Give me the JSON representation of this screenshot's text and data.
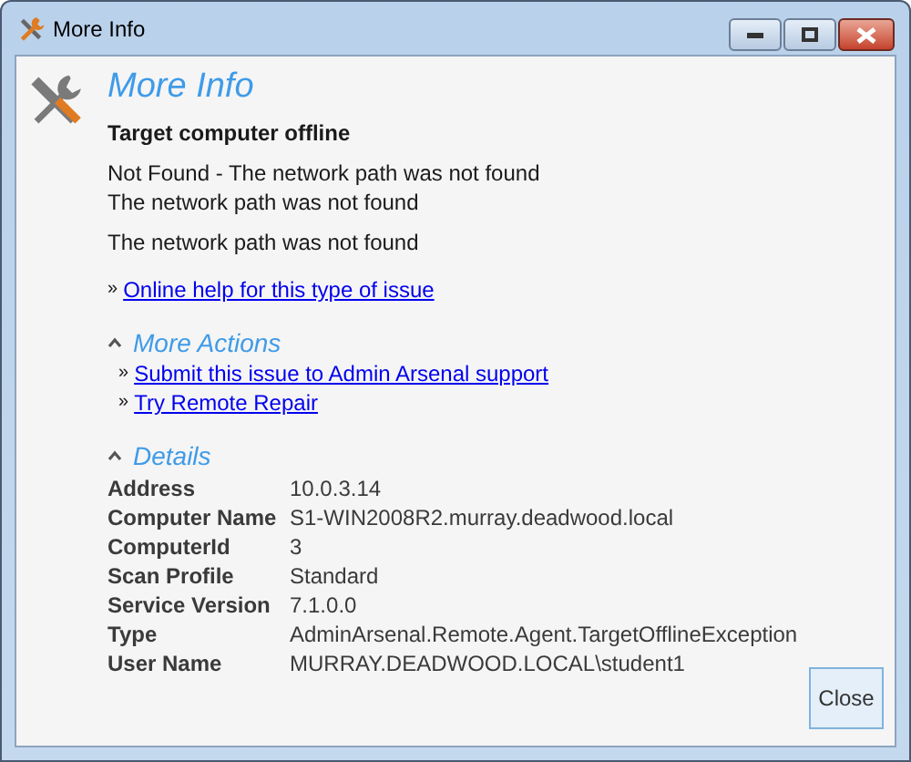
{
  "window": {
    "title": "More Info"
  },
  "heading": "More Info",
  "summary": "Target computer offline",
  "messages": [
    "Not Found - The network path was not found\nThe network path was not found",
    "The network path was not found"
  ],
  "help_link": {
    "bullet": "»",
    "text": "Online help for this type of issue"
  },
  "sections": [
    {
      "kind": "links",
      "title": "More Actions",
      "expanded": true,
      "links": [
        {
          "bullet": "»",
          "text": "Submit this issue to Admin Arsenal support"
        },
        {
          "bullet": "»",
          "text": "Try Remote Repair"
        }
      ]
    },
    {
      "kind": "details",
      "title": "Details",
      "expanded": true,
      "rows": [
        {
          "label": "Address",
          "value": "10.0.3.14"
        },
        {
          "label": "Computer Name",
          "value": "S1-WIN2008R2.murray.deadwood.local"
        },
        {
          "label": "ComputerId",
          "value": "3"
        },
        {
          "label": "Scan Profile",
          "value": "Standard"
        },
        {
          "label": "Service Version",
          "value": "7.1.0.0"
        },
        {
          "label": "Type",
          "value": "AdminArsenal.Remote.Agent.TargetOfflineException"
        },
        {
          "label": "User Name",
          "value": "MURRAY.DEADWOOD.LOCAL\\student1"
        }
      ]
    }
  ],
  "buttons": [
    "Close"
  ]
}
